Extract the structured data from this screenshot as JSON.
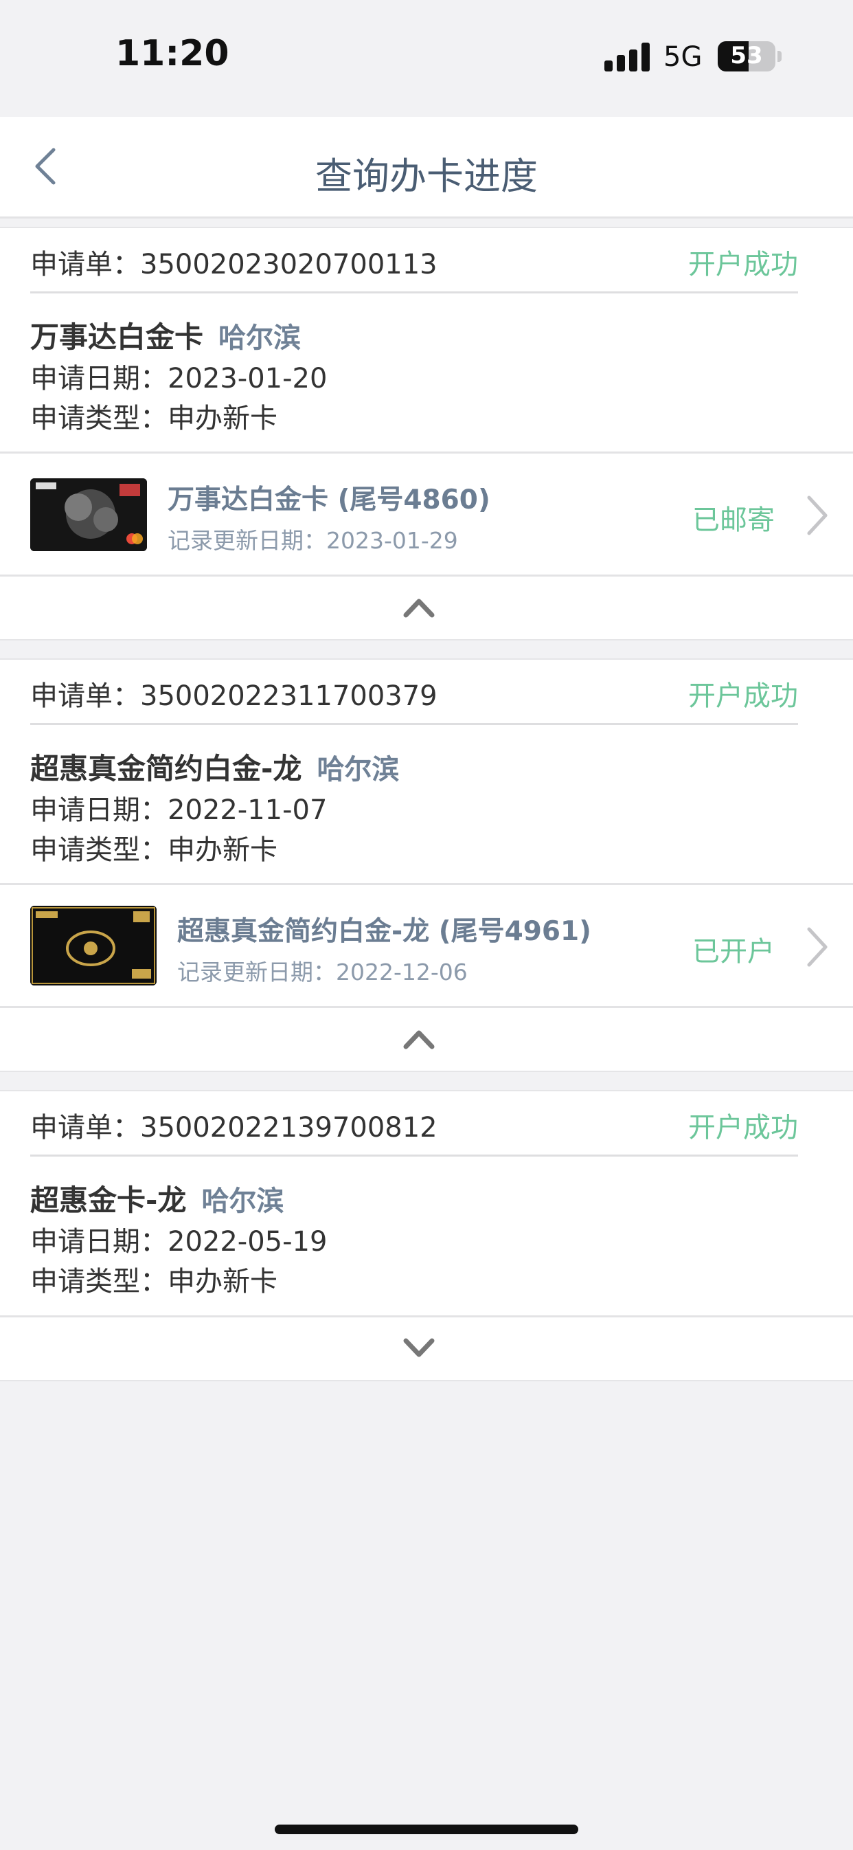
{
  "status_bar": {
    "time": "11:20",
    "network": "5G",
    "battery": "53"
  },
  "nav": {
    "title": "查询办卡进度"
  },
  "applications": [
    {
      "no": "申请单：35002023020700113",
      "status": "开户成功",
      "card_name": "万事达白金卡",
      "city": "哈尔滨",
      "date": "申请日期：2023-01-20",
      "type": "申请类型：申办新卡",
      "card": {
        "name": "万事达白金卡 (尾号4860)",
        "update": "记录更新日期：2023-01-29",
        "status": "已邮寄"
      }
    },
    {
      "no": "申请单：35002022311700379",
      "status": "开户成功",
      "card_name": "超惠真金简约白金-龙",
      "city": "哈尔滨",
      "date": "申请日期：2022-11-07",
      "type": "申请类型：申办新卡",
      "card": {
        "name": "超惠真金简约白金-龙 (尾号4961)",
        "update": "记录更新日期：2022-12-06",
        "status": "已开户"
      }
    },
    {
      "no": "申请单：35002022139700812",
      "status": "开户成功",
      "card_name": "超惠金卡-龙",
      "city": "哈尔滨",
      "date": "申请日期：2022-05-19",
      "type": "申请类型：申办新卡"
    }
  ],
  "colors": {
    "success": "#6cc69a",
    "title": "#4a5d73",
    "muted": "#6f8196"
  },
  "icons": [
    "back-arrow-icon",
    "chevron-right-icon",
    "chevron-up-icon",
    "chevron-down-icon",
    "signal-icon",
    "battery-icon"
  ]
}
